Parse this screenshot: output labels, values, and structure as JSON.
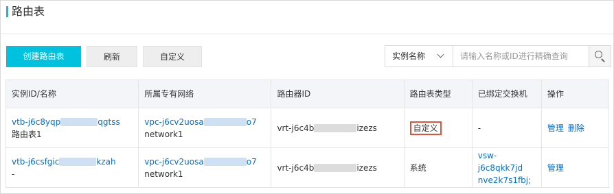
{
  "page": {
    "title": "路由表"
  },
  "toolbar": {
    "create_label": "创建路由表",
    "refresh_label": "刷新",
    "custom_label": "自定义"
  },
  "search": {
    "field_label": "实例名称",
    "placeholder": "请输入名称或ID进行精确查询"
  },
  "table": {
    "headers": [
      "实例ID/名称",
      "所属专有网络",
      "路由器ID",
      "路由表类型",
      "已绑定交换机",
      "操作"
    ],
    "rows": [
      {
        "id_prefix": "vtb-j6c8yqp",
        "id_suffix": "qgtss",
        "name": "路由表1",
        "vpc_prefix": "vpc-j6cv2uosa",
        "vpc_suffix": "o7",
        "vpc_name": "network1",
        "router_prefix": "vrt-j6c4b",
        "router_suffix": "izezs",
        "type": "自定义",
        "vswitch": "-",
        "ops": [
          "管理",
          "删除"
        ]
      },
      {
        "id_prefix": "vtb-j6csfgic",
        "id_suffix": "kzah",
        "name": "-",
        "vpc_prefix": "vpc-j6cv2uosa",
        "vpc_suffix": "o7",
        "vpc_name": "network1",
        "router_prefix": "vrt-j6c4b",
        "router_suffix": "izezs",
        "type": "系统",
        "vswitch_line1": "vsw-j6c8qkk7jd",
        "vswitch_line2": "nve2k7s1fbj;",
        "ops": [
          "管理"
        ]
      }
    ]
  },
  "colors": {
    "primary": "#00c1de",
    "link": "#0070cc",
    "highlight": "#e0533b"
  },
  "icons": {
    "search_button": "search-icon",
    "dropdown": "chevron-down-icon"
  }
}
